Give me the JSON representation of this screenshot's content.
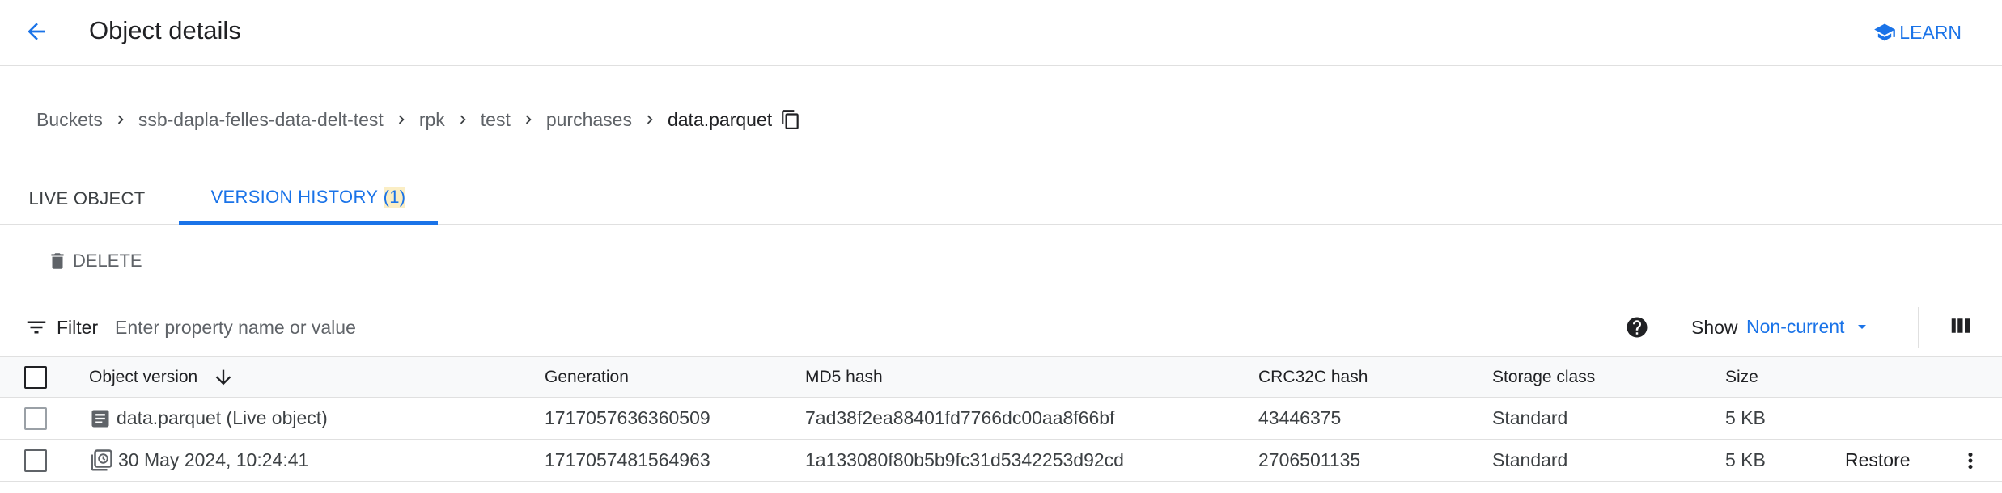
{
  "header": {
    "title": "Object details",
    "learn_label": "LEARN"
  },
  "breadcrumb": [
    {
      "label": "Buckets"
    },
    {
      "label": "ssb-dapla-felles-data-delt-test"
    },
    {
      "label": "rpk"
    },
    {
      "label": "test"
    },
    {
      "label": "purchases"
    },
    {
      "label": "data.parquet"
    }
  ],
  "tabs": {
    "live_object": "LIVE OBJECT",
    "version_history": "VERSION HISTORY",
    "version_history_count": "(1)"
  },
  "toolbar": {
    "delete_label": "DELETE"
  },
  "filter": {
    "label": "Filter",
    "placeholder": "Enter property name or value",
    "show_label": "Show",
    "show_value": "Non-current"
  },
  "table": {
    "columns": [
      "Object version",
      "Generation",
      "MD5 hash",
      "CRC32C hash",
      "Storage class",
      "Size"
    ],
    "rows": [
      {
        "version": "data.parquet (Live object)",
        "icon": "document-icon",
        "generation": "1717057636360509",
        "md5": "7ad38f2ea88401fd7766dc00aa8f66bf",
        "crc32c": "43446375",
        "storage_class": "Standard",
        "size": "5 KB",
        "action": ""
      },
      {
        "version": "30 May 2024, 10:24:41",
        "icon": "history-icon",
        "generation": "1717057481564963",
        "md5": "1a133080f80b5b9fc31d5342253d92cd",
        "crc32c": "2706501135",
        "storage_class": "Standard",
        "size": "5 KB",
        "action": "Restore"
      }
    ]
  },
  "colors": {
    "accent": "#1a73e8",
    "highlight": "#fbeec4",
    "divider": "#e0e0e0"
  }
}
